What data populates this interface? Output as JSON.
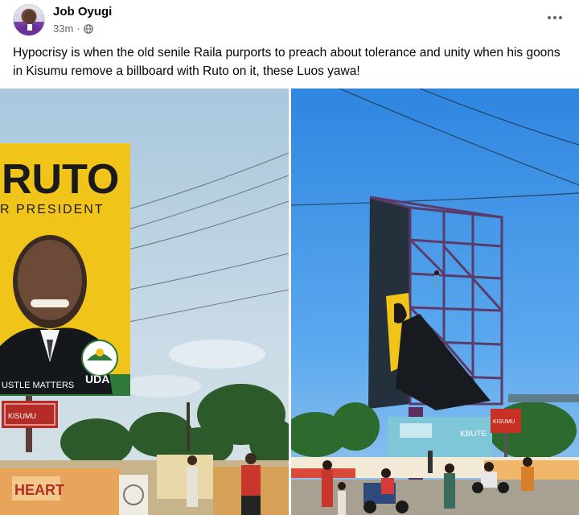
{
  "post": {
    "author": "Job Oyugi",
    "time": "33m",
    "separator": "·",
    "privacy_icon": "globe-icon",
    "more_icon": "more-options-icon",
    "text": "Hypocrisy is when the old senile Raila purports to preach about tolerance and unity when his goons in Kisumu remove a billboard with Ruto on it, these Luos yawa!"
  },
  "photo_left": {
    "billboard_title": "RUTO",
    "billboard_subtitle": "R PRESIDENT",
    "billboard_slogan": "USTLE MATTERS",
    "billboard_party": "UDA",
    "shop_sign": "HEART",
    "small_sign": "KISUMU"
  },
  "photo_right": {
    "building_sign": "KBUTE",
    "small_sign": "KISUMU"
  },
  "colors": {
    "sky_left": "#bcd3e4",
    "sky_right": "#3f95e8",
    "billboard_yellow": "#f0c419",
    "billboard_green": "#2f7a3a",
    "frame_purple": "#5b3b6b",
    "text_secondary": "#65676b"
  }
}
